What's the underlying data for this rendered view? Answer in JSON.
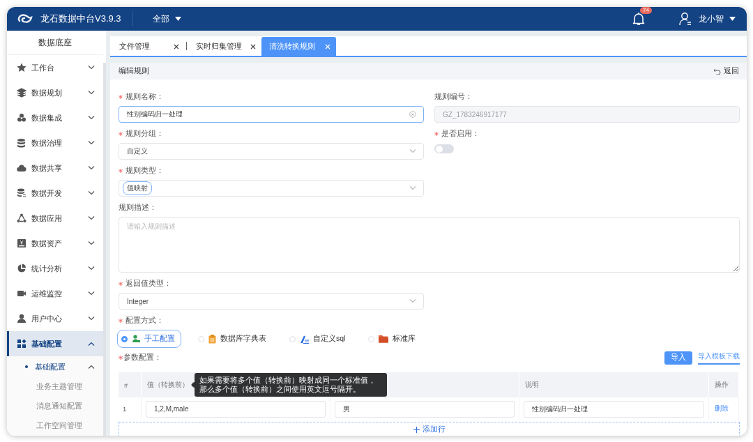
{
  "app": {
    "title": "龙石数据中台V3.9.3",
    "scope": "全部",
    "notification_count": "74",
    "user": "龙小智"
  },
  "sidebar": {
    "title": "数据底座",
    "items": [
      {
        "label": "工作台",
        "expanded": false,
        "selected": false
      },
      {
        "label": "数据规划",
        "expanded": false,
        "selected": false
      },
      {
        "label": "数据集成",
        "expanded": false,
        "selected": false
      },
      {
        "label": "数据治理",
        "expanded": false,
        "selected": false
      },
      {
        "label": "数据共享",
        "expanded": false,
        "selected": false
      },
      {
        "label": "数据开发",
        "expanded": false,
        "selected": false
      },
      {
        "label": "数据应用",
        "expanded": false,
        "selected": false
      },
      {
        "label": "数据资产",
        "expanded": false,
        "selected": false
      },
      {
        "label": "统计分析",
        "expanded": false,
        "selected": false
      },
      {
        "label": "运维监控",
        "expanded": false,
        "selected": false
      },
      {
        "label": "用户中心",
        "expanded": false,
        "selected": false
      },
      {
        "label": "基础配置",
        "expanded": true,
        "selected": true,
        "children": [
          {
            "label": "基础配置",
            "expanded": true,
            "selected": true,
            "children": [
              {
                "label": "业务主题管理",
                "selected": false
              },
              {
                "label": "消息通知配置",
                "selected": false
              },
              {
                "label": "工作空间管理",
                "selected": false
              }
            ]
          }
        ]
      }
    ]
  },
  "tabs": [
    {
      "label": "文件管理",
      "selected": false
    },
    {
      "label": "实时归集管理",
      "selected": false
    },
    {
      "label": "清洗转换规则",
      "selected": true
    }
  ],
  "page": {
    "title": "编辑规则",
    "back": "返回"
  },
  "form": {
    "name": {
      "label": "规则名称：",
      "required": true,
      "value": "性别编码归一处理"
    },
    "code": {
      "label": "规则编号：",
      "required": false,
      "value": "GZ_1783246917177",
      "disabled": true
    },
    "group": {
      "label": "规则分组：",
      "required": true,
      "value": "自定义"
    },
    "enabled": {
      "label": "是否启用：",
      "required": true,
      "on": false
    },
    "type": {
      "label": "规则类型：",
      "required": true,
      "tag": "值映射"
    },
    "description": {
      "label": "规则描述：",
      "required": false,
      "placeholder": "请输入规则描述"
    },
    "return_type": {
      "label": "返回值类型：",
      "required": true,
      "value": "Integer"
    },
    "config_mode": {
      "label": "配置方式：",
      "required": true,
      "options": [
        {
          "label": "手工配置",
          "selected": true
        },
        {
          "label": "数据库字典表",
          "selected": false
        },
        {
          "label": "自定义sql",
          "selected": false
        },
        {
          "label": "标准库",
          "selected": false
        }
      ]
    },
    "params": {
      "label": "参数配置：",
      "required": true,
      "import": "导入",
      "template": "导入模板下载",
      "columns": [
        "#",
        "值（转换前）",
        "说明",
        "操作"
      ],
      "rows": [
        {
          "index": "1",
          "value_before": "1,2,M,male",
          "column_3": "男",
          "note": "性别编码归一处理",
          "action": "删除"
        }
      ],
      "add_row": "添加行",
      "tooltip": "如果需要将多个值（转换前）映射成同一个标准值，那么多个值（转换前）之间使用英文逗号隔开。"
    }
  }
}
